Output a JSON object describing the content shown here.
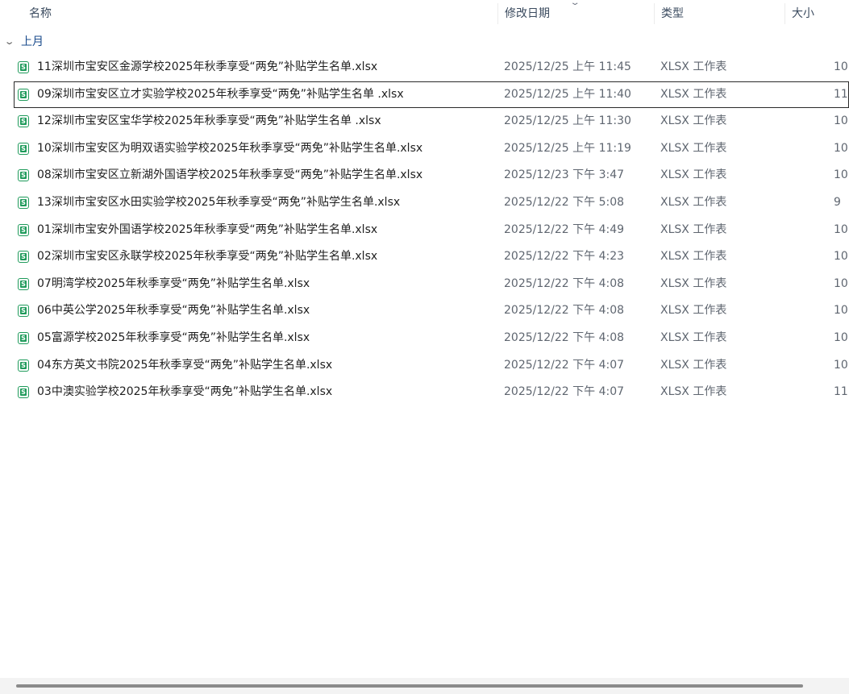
{
  "columns": {
    "name": "名称",
    "date": "修改日期",
    "type": "类型",
    "size": "大小"
  },
  "group": {
    "label": "上月",
    "chevron": "⌄"
  },
  "sort_indicator": "⌄",
  "icon_glyph": "S",
  "files": [
    {
      "name": "11深圳市宝安区金源学校2025年秋季享受“两免”补贴学生名单.xlsx",
      "date": "2025/12/25 上午 11:45",
      "type": "XLSX 工作表",
      "size": "10"
    },
    {
      "name": "09深圳市宝安区立才实验学校2025年秋季享受“两免”补贴学生名单 .xlsx",
      "date": "2025/12/25 上午 11:40",
      "type": "XLSX 工作表",
      "size": "11"
    },
    {
      "name": "12深圳市宝安区宝华学校2025年秋季享受“两免”补贴学生名单 .xlsx",
      "date": "2025/12/25 上午 11:30",
      "type": "XLSX 工作表",
      "size": "10"
    },
    {
      "name": "10深圳市宝安区为明双语实验学校2025年秋季享受“两免”补贴学生名单.xlsx",
      "date": "2025/12/25 上午 11:19",
      "type": "XLSX 工作表",
      "size": "10"
    },
    {
      "name": "08深圳市宝安区立新湖外国语学校2025年秋季享受“两免”补贴学生名单.xlsx",
      "date": "2025/12/23 下午 3:47",
      "type": "XLSX 工作表",
      "size": "10"
    },
    {
      "name": "13深圳市宝安区水田实验学校2025年秋季享受“两免”补贴学生名单.xlsx",
      "date": "2025/12/22 下午 5:08",
      "type": "XLSX 工作表",
      "size": "9"
    },
    {
      "name": "01深圳市宝安外国语学校2025年秋季享受“两免”补贴学生名单.xlsx",
      "date": "2025/12/22 下午 4:49",
      "type": "XLSX 工作表",
      "size": "10"
    },
    {
      "name": "02深圳市宝安区永联学校2025年秋季享受“两免”补贴学生名单.xlsx",
      "date": "2025/12/22 下午 4:23",
      "type": "XLSX 工作表",
      "size": "10"
    },
    {
      "name": "07明湾学校2025年秋季享受“两免”补贴学生名单.xlsx",
      "date": "2025/12/22 下午 4:08",
      "type": "XLSX 工作表",
      "size": "10"
    },
    {
      "name": "06中英公学2025年秋季享受“两免”补贴学生名单.xlsx",
      "date": "2025/12/22 下午 4:08",
      "type": "XLSX 工作表",
      "size": "10"
    },
    {
      "name": "05富源学校2025年秋季享受“两免”补贴学生名单.xlsx",
      "date": "2025/12/22 下午 4:08",
      "type": "XLSX 工作表",
      "size": "10"
    },
    {
      "name": "04东方英文书院2025年秋季享受“两免”补贴学生名单.xlsx",
      "date": "2025/12/22 下午 4:07",
      "type": "XLSX 工作表",
      "size": "10"
    },
    {
      "name": "03中澳实验学校2025年秋季享受“两免”补贴学生名单.xlsx",
      "date": "2025/12/22 下午 4:07",
      "type": "XLSX 工作表",
      "size": "11"
    }
  ]
}
